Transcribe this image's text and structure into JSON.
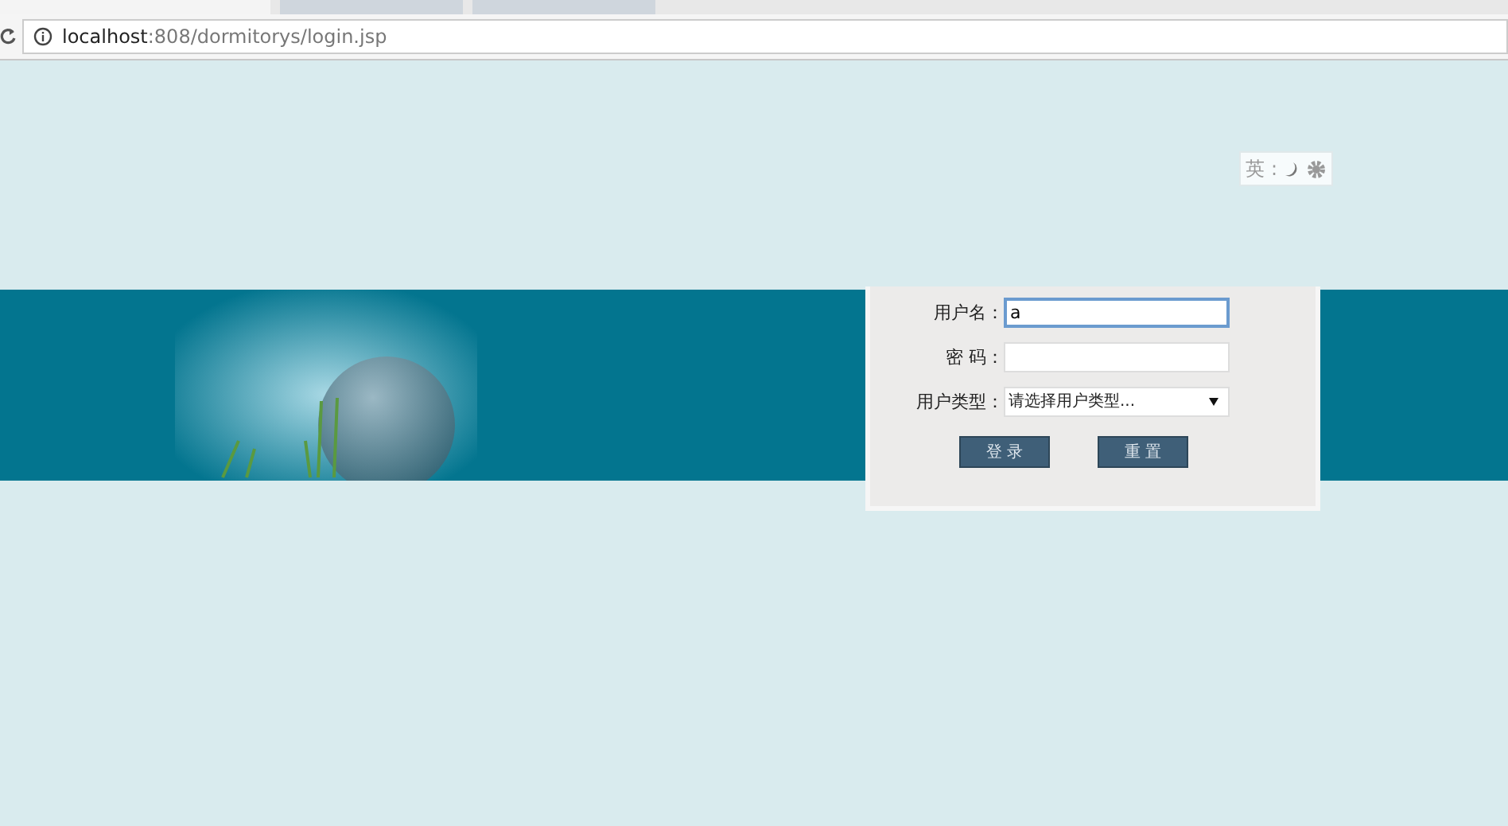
{
  "browser": {
    "tabs": [
      {
        "selected": true
      },
      {
        "selected": false
      },
      {
        "selected": false
      }
    ],
    "address": {
      "host": "localhost",
      "rest": ":808/dormitorys/login.jsp"
    }
  },
  "ime": {
    "mode": "英",
    "separator": ":"
  },
  "login": {
    "fields": [
      {
        "kind": "text",
        "label": "用户名：",
        "value": "a",
        "focused": true
      },
      {
        "kind": "password",
        "label": "密 码：",
        "focused": false
      },
      {
        "kind": "select",
        "label": "用户类型：",
        "value": "请选择用户类型...",
        "focused": false
      }
    ],
    "buttons": [
      "登 录",
      "重 置"
    ]
  }
}
